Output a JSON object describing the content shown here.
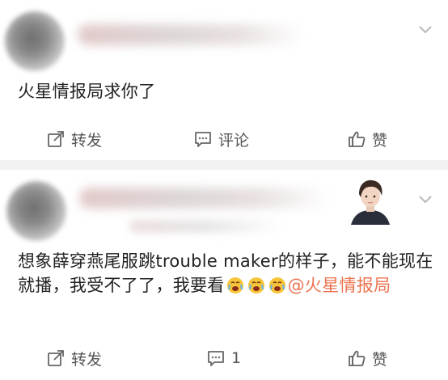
{
  "comments": [
    {
      "text": "火星情报局求你了",
      "actions": {
        "repost_label": "转发",
        "comment_label": "评论",
        "like_label": "赞"
      }
    },
    {
      "text_main": "想象薛穿燕尾服跳trouble maker的样子，能不能现在就播，我受不了了，我要看",
      "mention": "@火星情报局",
      "actions": {
        "repost_label": "转发",
        "comment_label": "1",
        "like_label": "赞"
      }
    }
  ],
  "icons": {
    "repost": "repost-icon",
    "comment": "comment-icon",
    "like": "thumbs-up-icon",
    "more": "chevron-down-icon",
    "emoji": "crying-face-emoji"
  },
  "colors": {
    "mention": "#eb7350",
    "text": "#222222",
    "action_text": "#555555",
    "separator": "#f2f2f2"
  }
}
